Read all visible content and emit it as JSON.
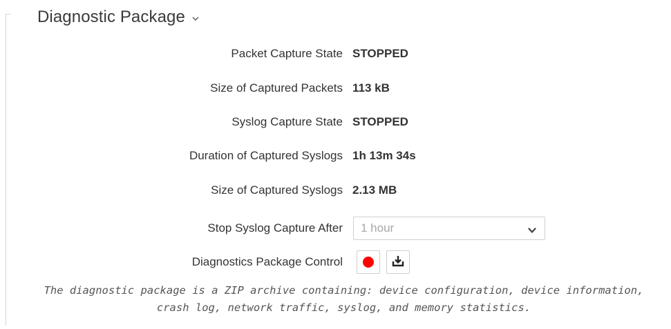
{
  "section": {
    "title": "Diagnostic Package",
    "chevron_icon": "chevron-down-icon"
  },
  "rows": {
    "packet_capture_state": {
      "label": "Packet Capture State",
      "value": "STOPPED"
    },
    "size_captured_packets": {
      "label": "Size of Captured Packets",
      "value": "113 kB"
    },
    "syslog_capture_state": {
      "label": "Syslog Capture State",
      "value": "STOPPED"
    },
    "duration_captured_syslogs": {
      "label": "Duration of Captured Syslogs",
      "value": "1h 13m 34s"
    },
    "size_captured_syslogs": {
      "label": "Size of Captured Syslogs",
      "value": "2.13 MB"
    }
  },
  "stop_syslog": {
    "label": "Stop Syslog Capture After",
    "selected": "1 hour"
  },
  "package_control": {
    "label": "Diagnostics Package Control",
    "record_icon": "record-icon",
    "download_icon": "download-icon",
    "record_color": "#ff0000"
  },
  "description": "The diagnostic package is a ZIP archive containing: device configuration, device information, crash log, network traffic, syslog, and memory statistics."
}
